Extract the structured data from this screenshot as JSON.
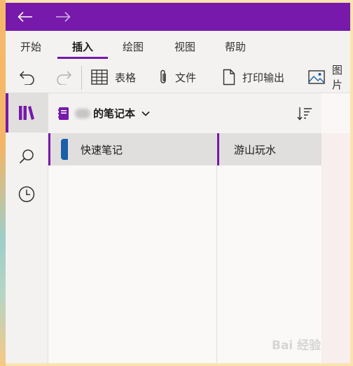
{
  "titlebar": {
    "back_icon": "arrow-left-icon",
    "forward_icon": "arrow-right-icon",
    "accent": "#7719aa"
  },
  "ribbon": {
    "tabs": [
      {
        "label": "开始"
      },
      {
        "label": "插入",
        "active": true
      },
      {
        "label": "绘图"
      },
      {
        "label": "视图"
      },
      {
        "label": "帮助"
      }
    ]
  },
  "toolbar": {
    "undo_icon": "undo-icon",
    "redo_icon": "redo-icon",
    "table_label": "表格",
    "file_label": "文件",
    "printout_label": "打印输出",
    "picture_label": "图片"
  },
  "rail": {
    "items": [
      "notebooks-icon",
      "search-icon",
      "recent-icon"
    ]
  },
  "notebook": {
    "title": "的笔记本"
  },
  "sections": [
    {
      "label": "快速笔记",
      "color": "#1b5fa8"
    }
  ],
  "pages": [
    {
      "label": "游山玩水"
    }
  ],
  "watermark": {
    "text": "Bai 经验"
  }
}
